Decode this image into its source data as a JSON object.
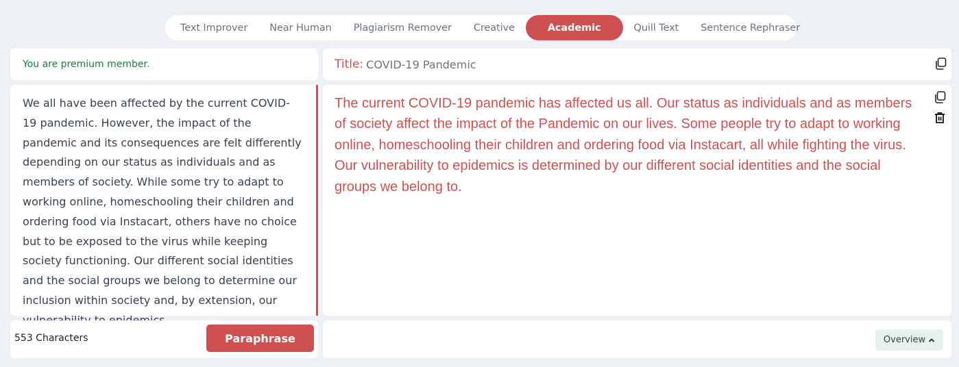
{
  "tabs": [
    {
      "label": "Text Improver",
      "active": false
    },
    {
      "label": "Near Human",
      "active": false
    },
    {
      "label": "Plagiarism Remover",
      "active": false
    },
    {
      "label": "Creative",
      "active": false
    },
    {
      "label": "Academic",
      "active": true
    },
    {
      "label": "Quill Text",
      "active": false
    },
    {
      "label": "Sentence Rephraser",
      "active": false
    }
  ],
  "status": {
    "premium_text": "You are premium member."
  },
  "title": {
    "label": "Title:",
    "value": "COVID-19 Pandemic"
  },
  "input": {
    "text": "We all have been affected by the current COVID-19 pandemic. However, the impact of the pandemic and its consequences are felt differently depending on our status as individuals and as members of society. While some try to adapt to working online, homeschooling their children and ordering food via Instacart, others have no choice but to be exposed to the virus while keeping society functioning. Our different social identities and the social groups we belong to determine our inclusion within society and, by extension, our vulnerability to epidemics."
  },
  "output": {
    "text": "The current COVID-19 pandemic has affected us all. Our status as individuals and as members of society affect the impact of the Pandemic on our lives. Some people try to adapt to working online, homeschooling their children and ordering food via Instacart, all while fighting the virus. Our vulnerability to epidemics is determined by our different social identities and the social groups we belong to."
  },
  "footer": {
    "char_count": "553 Characters",
    "paraphrase_label": "Paraphrase",
    "overview_label": "Overview"
  },
  "icons": {
    "copy_title": "copy-icon",
    "copy_output": "copy-icon",
    "delete_output": "trash-icon",
    "overview_toggle": "chevron-up-icon"
  },
  "colors": {
    "accent": "#cf5050",
    "premium_text": "#15803d",
    "background": "#edf1f5",
    "overview_bg": "#e5f2ec"
  }
}
